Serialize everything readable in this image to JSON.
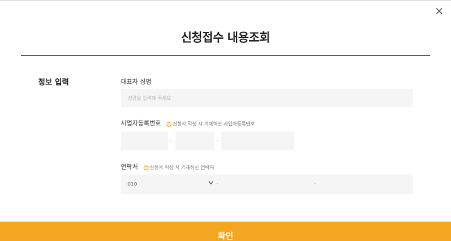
{
  "modal": {
    "title": "신청접수 내용조회",
    "close_icon": "close-icon"
  },
  "section": {
    "label": "정보 입력"
  },
  "fields": {
    "name": {
      "label": "대표자 성명",
      "placeholder": "성명을 입력해 주세요"
    },
    "business_number": {
      "label": "사업자등록번호",
      "hint": "신청서 작성 시 기재하신 사업자등록번호",
      "separator": "-"
    },
    "contact": {
      "label": "연락처",
      "hint": "신청서 작성 시 기재하신 연락처",
      "prefix_selected": "010",
      "separator": "-"
    }
  },
  "actions": {
    "confirm_label": "확인"
  },
  "colors": {
    "accent": "#f5a623",
    "hint_icon": "#f39c12",
    "input_bg": "#f5f5f5"
  }
}
